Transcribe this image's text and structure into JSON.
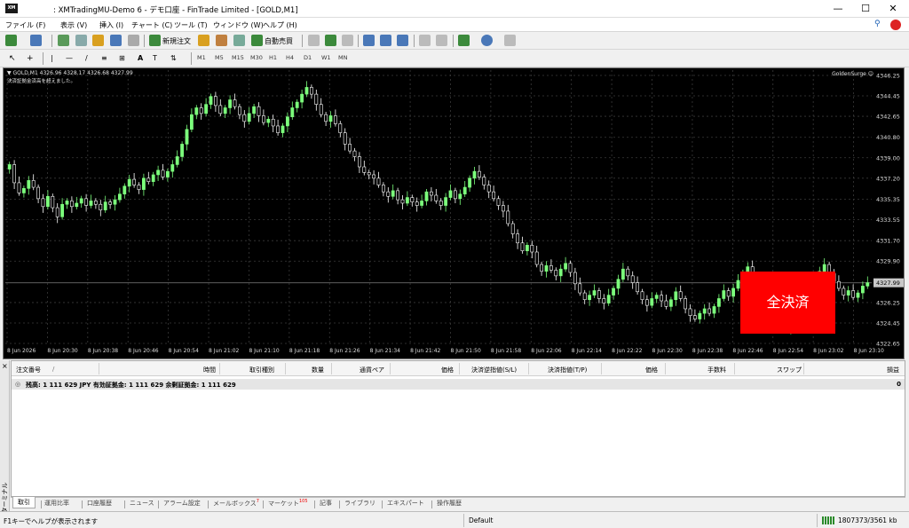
{
  "window": {
    "title": ": XMTradingMU-Demo 6 - デモ口座 - FinTrade Limited - [GOLD,M1]",
    "logo_text": "XM",
    "minimize": "—",
    "maximize": "☐",
    "close": "✕"
  },
  "menu": [
    {
      "label": "ファイル (F)"
    },
    {
      "label": "表示 (V)"
    },
    {
      "label": "挿入 (I)"
    },
    {
      "label": "チャート (C)"
    },
    {
      "label": "ツール (T)"
    },
    {
      "label": "ウィンドウ (W)"
    },
    {
      "label": "ヘルプ (H)"
    }
  ],
  "toolbar": {
    "new_order": "新規注文",
    "auto_trading": "自動売買"
  },
  "timeframes": [
    "M1",
    "M5",
    "M15",
    "M30",
    "H1",
    "H4",
    "D1",
    "W1",
    "MN"
  ],
  "chart": {
    "info": "▼ GOLD,M1  4326.96 4328.17 4326.68 4327.99",
    "warning": "決済証拠金済高を超えました。",
    "ea_label": "GoldenSurge ☺",
    "close_all_button": "全決済",
    "current_price_label": "4327.99",
    "colors": {
      "background": "#000000",
      "bull": "#7cff7c",
      "bear": "#ffffff",
      "grid": "#3a3a3a"
    }
  },
  "chart_data": {
    "type": "candlestick",
    "symbol": "GOLD",
    "timeframe": "M1",
    "ylim": [
      4322.65,
      4346.25
    ],
    "y_ticks": [
      "4346.25",
      "4344.45",
      "4342.65",
      "4340.80",
      "4339.00",
      "4337.20",
      "4335.35",
      "4333.55",
      "4331.70",
      "4329.90",
      "4327.99",
      "4326.25",
      "4324.45",
      "4322.65"
    ],
    "x_ticks": [
      "8 Jun 2026",
      "8 Jun 20:30",
      "8 Jun 20:38",
      "8 Jun 20:46",
      "8 Jun 20:54",
      "8 Jun 21:02",
      "8 Jun 21:10",
      "8 Jun 21:18",
      "8 Jun 21:26",
      "8 Jun 21:34",
      "8 Jun 21:42",
      "8 Jun 21:50",
      "8 Jun 21:58",
      "8 Jun 22:06",
      "8 Jun 22:14",
      "8 Jun 22:22",
      "8 Jun 22:30",
      "8 Jun 22:38",
      "8 Jun 22:46",
      "8 Jun 22:54",
      "8 Jun 23:02",
      "8 Jun 23:10"
    ],
    "close": [
      4338.4,
      4336.8,
      4335.9,
      4336.3,
      4337.0,
      4336.4,
      4335.4,
      4334.7,
      4335.6,
      4334.6,
      4333.8,
      4334.9,
      4335.2,
      4334.7,
      4335.0,
      4335.4,
      4334.8,
      4335.2,
      4334.9,
      4334.4,
      4335.1,
      4334.9,
      4335.3,
      4335.8,
      4336.5,
      4337.1,
      4336.6,
      4336.2,
      4337.2,
      4336.9,
      4337.5,
      4337.9,
      4337.3,
      4337.8,
      4338.4,
      4339.1,
      4340.2,
      4341.5,
      4342.8,
      4343.4,
      4342.9,
      4343.7,
      4344.4,
      4343.6,
      4342.9,
      4343.4,
      4344.1,
      4343.5,
      4342.8,
      4342.2,
      4342.9,
      4343.5,
      4342.7,
      4342.1,
      4342.4,
      4341.8,
      4341.2,
      4341.8,
      4342.6,
      4343.4,
      4343.9,
      4344.6,
      4345.2,
      4344.6,
      4343.7,
      4342.8,
      4342.2,
      4342.7,
      4342.0,
      4341.2,
      4340.2,
      4339.6,
      4339.1,
      4338.2,
      4337.7,
      4337.5,
      4337.2,
      4336.6,
      4336.0,
      4335.6,
      4336.1,
      4335.3,
      4335.0,
      4335.5,
      4335.1,
      4334.8,
      4335.2,
      4336.0,
      4335.7,
      4335.2,
      4334.8,
      4335.5,
      4336.1,
      4335.4,
      4335.8,
      4336.4,
      4337.2,
      4337.8,
      4337.3,
      4336.6,
      4336.0,
      4335.4,
      4334.8,
      4334.3,
      4333.2,
      4332.3,
      4331.5,
      4330.8,
      4331.3,
      4330.7,
      4329.6,
      4329.0,
      4329.5,
      4329.1,
      4328.6,
      4329.2,
      4329.7,
      4328.9,
      4327.9,
      4327.1,
      4326.5,
      4326.9,
      4327.3,
      4326.6,
      4326.2,
      4326.9,
      4327.5,
      4328.3,
      4329.2,
      4328.6,
      4328.0,
      4327.2,
      4326.5,
      4326.0,
      4326.6,
      4326.9,
      4326.4,
      4325.9,
      4326.5,
      4327.2,
      4326.6,
      4325.7,
      4325.1,
      4324.8,
      4325.3,
      4325.7,
      4325.3,
      4325.9,
      4326.6,
      4327.3,
      4326.8,
      4327.5,
      4328.2,
      4328.9,
      4329.4,
      4328.6,
      4327.8,
      4327.2,
      4326.4,
      4325.8,
      4325.2,
      4324.7,
      4324.0,
      4324.8,
      4325.5,
      4326.2,
      4326.9,
      4327.6,
      4328.3,
      4329.0,
      4329.6,
      4328.8,
      4328.1,
      4327.5,
      4326.9,
      4327.3,
      4326.7,
      4327.1,
      4327.7,
      4328.0
    ]
  },
  "terminal": {
    "side_label": "ターミナル",
    "columns": [
      "注文番号",
      "/",
      "時間",
      "取引種別",
      "数量",
      "通貨ペア",
      "価格",
      "決済逆指値(S/L)",
      "決済指値(T/P)",
      "価格",
      "手数料",
      "スワップ",
      "損益"
    ],
    "balance_line": "残高: 1 111 629 JPY  有効証拠金: 1 111 629  余剰証拠金: 1 111 629",
    "balance_pl": "0",
    "tabs": [
      {
        "label": "取引"
      },
      {
        "label": "運用比率"
      },
      {
        "label": "口座履歴"
      },
      {
        "label": "ニュース"
      },
      {
        "label": "アラーム設定"
      },
      {
        "label": "メールボックス",
        "badge": "7"
      },
      {
        "label": "マーケット",
        "badge": "105"
      },
      {
        "label": "記事"
      },
      {
        "label": "ライブラリ"
      },
      {
        "label": "エキスパート"
      },
      {
        "label": "操作履歴"
      }
    ]
  },
  "status": {
    "help": "F1キーでヘルプが表示されます",
    "profile": "Default",
    "traffic": "1807373/3561 kb"
  }
}
